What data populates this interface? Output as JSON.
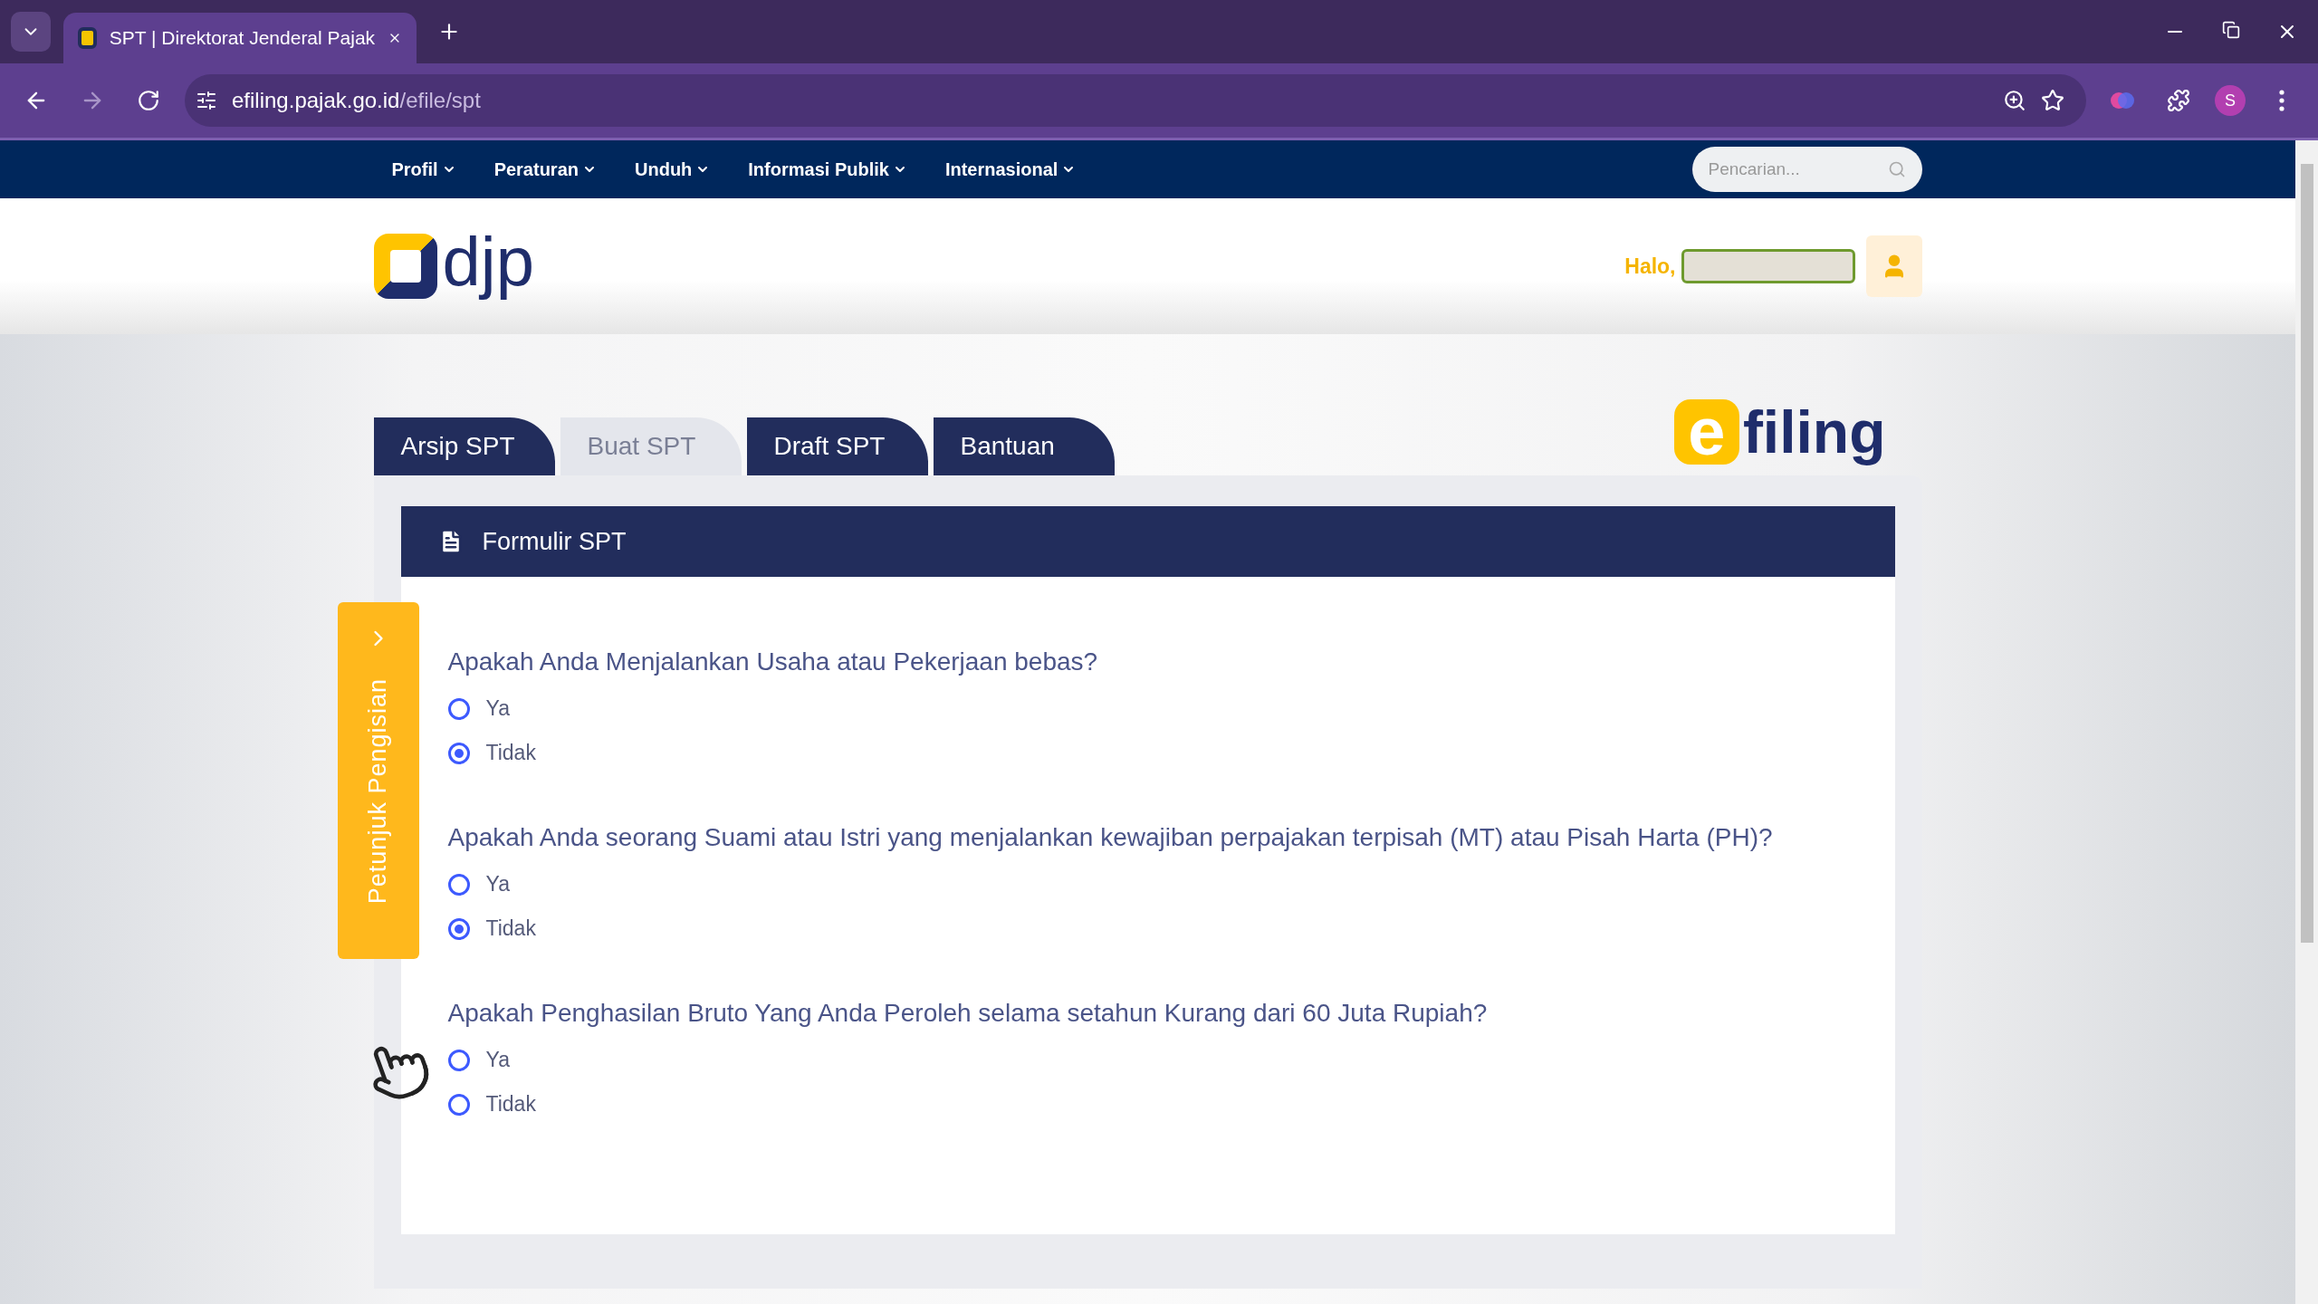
{
  "browser": {
    "tab_title": "SPT | Direktorat Jenderal Pajak",
    "url_host": "efiling.pajak.go.id",
    "url_path": "/efile/spt",
    "profile_initial": "S"
  },
  "nav": {
    "items": [
      {
        "label": "Profil"
      },
      {
        "label": "Peraturan"
      },
      {
        "label": "Unduh"
      },
      {
        "label": "Informasi Publik"
      },
      {
        "label": "Internasional"
      }
    ],
    "search": {
      "placeholder": "Pencarian..."
    }
  },
  "header": {
    "logo_text": "djp",
    "greeting": "Halo,"
  },
  "tabs": [
    {
      "label": "Arsip SPT",
      "selected": false
    },
    {
      "label": "Buat SPT",
      "selected": true
    },
    {
      "label": "Draft SPT",
      "selected": false
    },
    {
      "label": "Bantuan",
      "selected": false
    }
  ],
  "efiling_logo": {
    "mark": "e",
    "text": "filing"
  },
  "side_tab": {
    "label": "Petunjuk Pengisian"
  },
  "form": {
    "title": "Formulir SPT",
    "questions": [
      {
        "text": "Apakah Anda Menjalankan Usaha atau Pekerjaan bebas?",
        "options": [
          {
            "label": "Ya",
            "selected": false
          },
          {
            "label": "Tidak",
            "selected": true
          }
        ]
      },
      {
        "text": "Apakah Anda seorang Suami atau Istri yang menjalankan kewajiban perpajakan terpisah (MT) atau Pisah Harta (PH)?",
        "options": [
          {
            "label": "Ya",
            "selected": false
          },
          {
            "label": "Tidak",
            "selected": true
          }
        ]
      },
      {
        "text": "Apakah Penghasilan Bruto Yang Anda Peroleh selama setahun Kurang dari 60 Juta Rupiah?",
        "options": [
          {
            "label": "Ya",
            "selected": false
          },
          {
            "label": "Tidak",
            "selected": false
          }
        ]
      }
    ]
  }
}
